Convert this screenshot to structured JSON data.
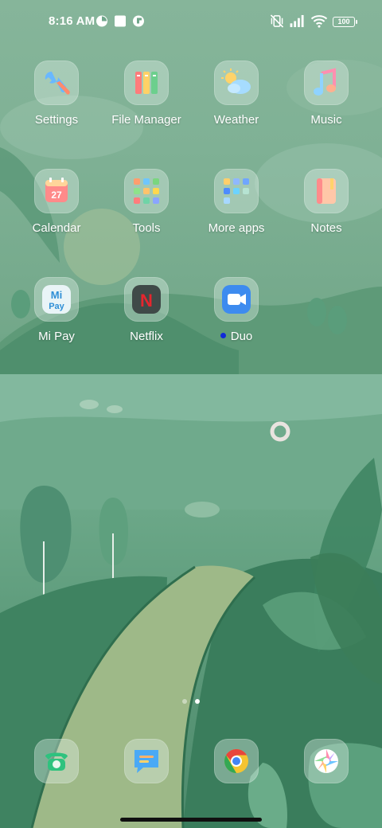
{
  "status_bar": {
    "time": "8:16 AM",
    "notification_icons": [
      "speedometer-icon",
      "square-notification-icon",
      "app-notification-icon"
    ],
    "system_icons": [
      "vibrate-off-icon",
      "signal-icon",
      "wifi-icon"
    ],
    "battery": "100"
  },
  "home": {
    "apps": [
      {
        "label": "Settings",
        "icon": "wrench-icon"
      },
      {
        "label": "File Manager",
        "icon": "folders-icon"
      },
      {
        "label": "Weather",
        "icon": "sun-cloud-icon"
      },
      {
        "label": "Music",
        "icon": "music-note-icon"
      },
      {
        "label": "Calendar",
        "icon": "calendar-icon",
        "date": "27"
      },
      {
        "label": "Tools",
        "icon": "folder-grid-icon"
      },
      {
        "label": "More apps",
        "icon": "folder-grid-icon"
      },
      {
        "label": "Notes",
        "icon": "notebook-icon"
      },
      {
        "label": "Mi Pay",
        "icon": "mi-pay-icon",
        "badge_top": "Mi",
        "badge_bottom": "Pay"
      },
      {
        "label": "Netflix",
        "icon": "netflix-icon",
        "letter": "N"
      },
      {
        "label": "Duo",
        "icon": "video-camera-icon",
        "new_indicator": true
      }
    ],
    "page_indicator": {
      "pages": 2,
      "current": 2
    }
  },
  "dock": {
    "apps": [
      {
        "icon": "phone-icon"
      },
      {
        "icon": "messages-icon"
      },
      {
        "icon": "chrome-icon"
      },
      {
        "icon": "camera-aperture-icon"
      }
    ]
  }
}
